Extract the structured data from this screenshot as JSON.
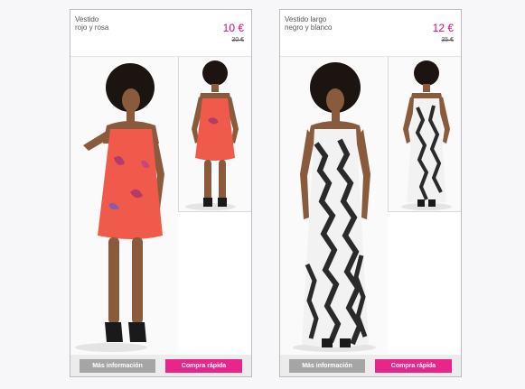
{
  "products": [
    {
      "name_line1": "Vestido",
      "name_line2": "rojo y rosa",
      "price": "10 €",
      "old_price": "30 €",
      "more_info_label": "Más información",
      "quick_buy_label": "Compra rápida",
      "dress_color": "#ef5a4a"
    },
    {
      "name_line1": "Vestido largo",
      "name_line2": "negro y blanco",
      "price": "12 €",
      "old_price": "35 €",
      "more_info_label": "Más información",
      "quick_buy_label": "Compra rápida",
      "dress_color": "#f2f2f2"
    }
  ],
  "colors": {
    "accent": "#e8268a",
    "price": "#e6007e",
    "info_button": "#a5a5a5"
  }
}
